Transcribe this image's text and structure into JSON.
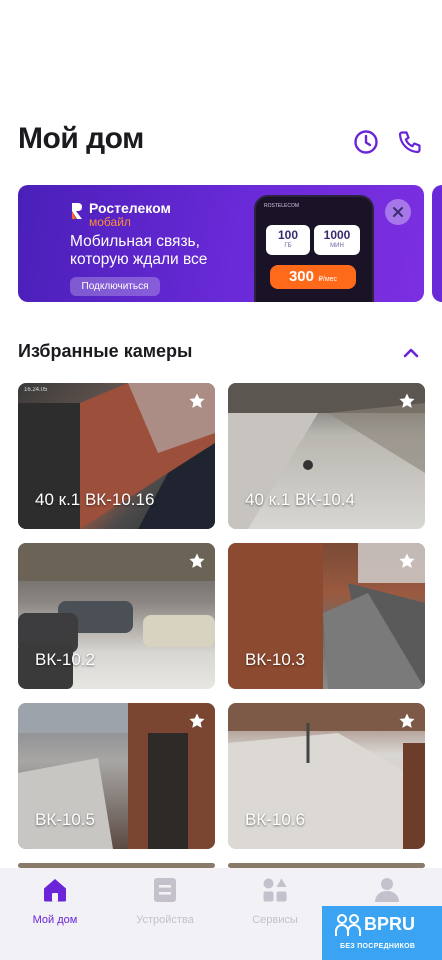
{
  "header": {
    "title": "Мой дом",
    "history_icon": "clock-icon",
    "call_icon": "phone-icon"
  },
  "banner": {
    "brand_name": "Ростелеком",
    "brand_sub": "мобайл",
    "headline": "Мобильная связь, которую ждали все",
    "button_label": "Подключиться",
    "phone_brand": "ROSTELECOM",
    "gb_value": "100",
    "gb_unit": "ГБ",
    "min_value": "1000",
    "min_unit": "МИН",
    "price": "300",
    "price_unit": "₽/мес",
    "close_icon": "close-icon",
    "colors": {
      "accent": "#6a2ad8",
      "price": "#ff6a1a"
    }
  },
  "favorites": {
    "title": "Избранные камеры",
    "collapse_icon": "chevron-up-icon",
    "cameras": [
      {
        "label": "40 к.1 ВК-10.16",
        "timestamp": "16.24.05"
      },
      {
        "label": "40 к.1 ВК-10.4",
        "timestamp": ""
      },
      {
        "label": "ВК-10.2",
        "timestamp": ""
      },
      {
        "label": "ВК-10.3",
        "timestamp": ""
      },
      {
        "label": "ВК-10.5",
        "timestamp": ""
      },
      {
        "label": "ВК-10.6",
        "timestamp": ""
      }
    ]
  },
  "tabbar": {
    "items": [
      {
        "label": "Мой дом",
        "icon": "home-icon",
        "active": true
      },
      {
        "label": "Устройства",
        "icon": "devices-icon",
        "active": false
      },
      {
        "label": "Сервисы",
        "icon": "services-icon",
        "active": false
      },
      {
        "label": "",
        "icon": "profile-icon",
        "active": false
      }
    ],
    "colors": {
      "active": "#6a25d8",
      "inactive": "#c4c0cc"
    }
  },
  "watermark": {
    "name": "BPRU",
    "sub": "БЕЗ ПОСРЕДНИКОВ"
  }
}
